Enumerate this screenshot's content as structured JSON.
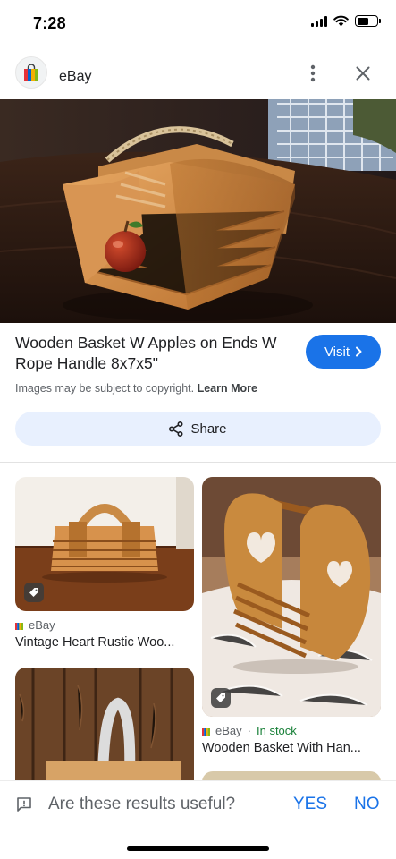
{
  "status": {
    "time": "7:28"
  },
  "header": {
    "site_name": "eBay"
  },
  "product": {
    "title": "Wooden Basket W Apples on Ends W Rope Handle 8x7x5\"",
    "visit_label": "Visit",
    "copyright_text": "Images may be subject to copyright.",
    "learn_more": "Learn More",
    "share_label": "Share"
  },
  "results": [
    {
      "source": "eBay",
      "stock": "",
      "title": "Vintage Heart Rustic Woo..."
    },
    {
      "source": "eBay",
      "stock": "In stock",
      "title": "Wooden Basket With Han..."
    }
  ],
  "feedback": {
    "question": "Are these results useful?",
    "yes": "YES",
    "no": "NO"
  },
  "colors": {
    "accent": "#1a73e8",
    "share_bg": "#e8f0fe",
    "in_stock": "#188038"
  },
  "icons": [
    "ebay-bag-icon",
    "more-vert-icon",
    "close-icon",
    "chevron-right-icon",
    "share-icon",
    "price-tag-icon",
    "feedback-icon"
  ]
}
